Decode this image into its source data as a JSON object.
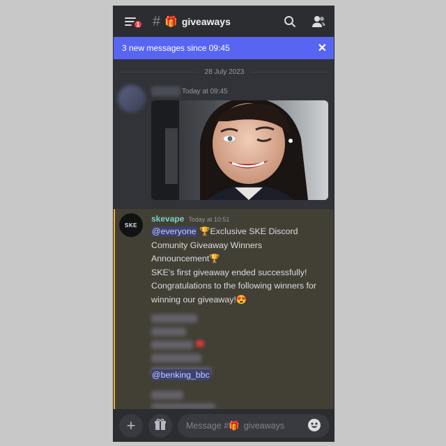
{
  "header": {
    "badge_count": "1",
    "hash": "#",
    "channel_emoji": "🎁",
    "channel_name": "giveaways"
  },
  "new_messages_bar": {
    "text": "3 new messages since 09:45",
    "close": "✕"
  },
  "date_divider": "28 July 2023",
  "message1": {
    "time": "Today at 09:45"
  },
  "message2": {
    "avatar_text": "SKE",
    "author": "skevape",
    "time": "Today at 10:51",
    "mention": "@everyone",
    "lines": {
      "l1_rest": "🏆Exclusive SKE Discord",
      "l2": "Comunity Giveaway Winners",
      "l3": "Announcement🏆",
      "l4": "SKE's first giveaway ended successfully!",
      "l5": "Congratulations to the following winners for",
      "l6": "winning our giveaway!😍"
    },
    "visible_mention": "@benking_bbc"
  },
  "composer": {
    "placeholder_prefix": "Message #",
    "placeholder_emoji": "🎁",
    "placeholder_channel": "giveaways",
    "plus": "+"
  },
  "icons": [
    "menu-icon",
    "search-icon",
    "members-icon",
    "gift-icon",
    "emoji-icon",
    "close-icon"
  ],
  "colors": {
    "accent": "#5865f2",
    "highlight_border": "#f0b232",
    "mention_bg": "#3c4270",
    "badge": "#f23f43"
  }
}
